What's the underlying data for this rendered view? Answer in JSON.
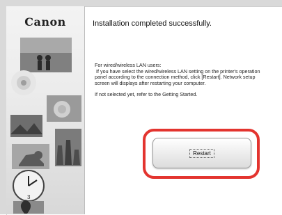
{
  "window": {
    "logo": "Canon",
    "title": "Installation completed successfully."
  },
  "message": {
    "p1_line1": "For wired/wireless LAN users:",
    "p1_line2": "If you have select the wired/wireless LAN setting on the printer's operation panel according to the connection method, click [Restart]. Network setup screen will displays after restarting your computer.",
    "p2": "If not selected yet, refer to the Getting Started."
  },
  "buttons": {
    "restart_label": "Restart"
  },
  "colors": {
    "highlight": "#e3342f"
  }
}
